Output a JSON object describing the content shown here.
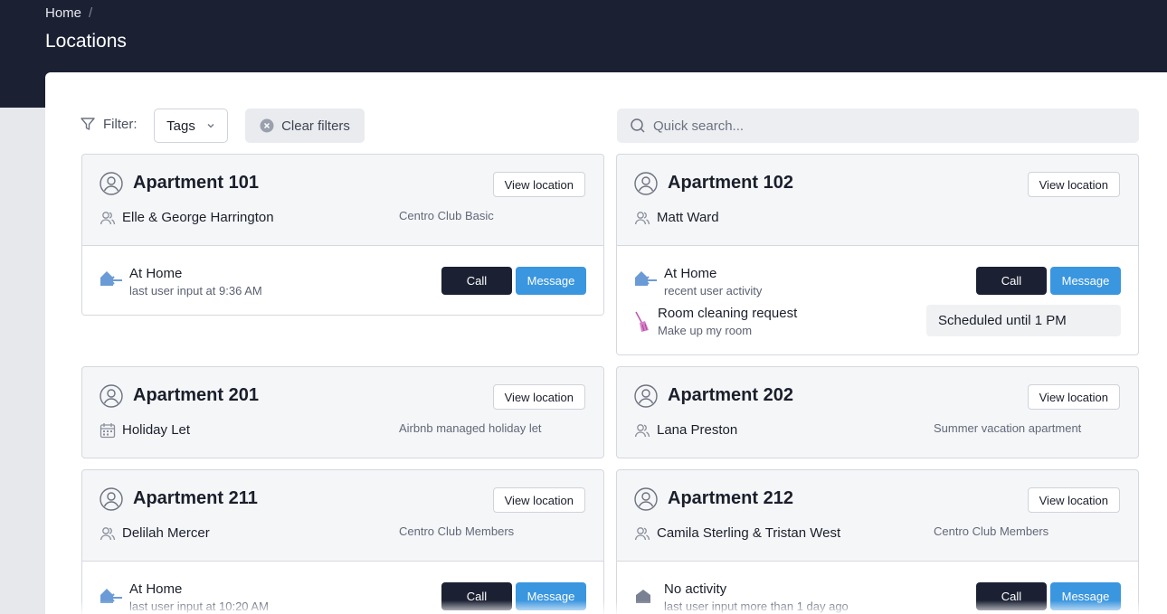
{
  "header": {
    "breadcrumb": [
      "Home"
    ],
    "breadcrumb_sep": "/",
    "title": "Locations"
  },
  "toolbar": {
    "filter_label": "Filter:",
    "tags_label": "Tags",
    "clear_label": "Clear filters",
    "search_placeholder": "Quick search...",
    "search_value": ""
  },
  "buttons": {
    "view": "View location",
    "call": "Call",
    "message": "Message"
  },
  "cards": [
    {
      "title": "Apartment 101",
      "occupant": "Elle & George Harrington",
      "occupant_icon": "users-icon",
      "tag": "Centro Club Basic",
      "status": {
        "icon": "home-arrow-icon",
        "title": "At Home",
        "sub": "last user input at 9:36 AM"
      }
    },
    {
      "title": "Apartment 102",
      "occupant": "Matt Ward",
      "occupant_icon": "users-icon",
      "tag": "",
      "status": {
        "icon": "home-arrow-icon",
        "title": "At Home",
        "sub": "recent user activity"
      },
      "request": {
        "icon": "broom-icon",
        "title": "Room cleaning request",
        "sub": "Make up my room",
        "schedule": "Scheduled until 1 PM"
      }
    },
    {
      "title": "Apartment 201",
      "occupant": "Holiday Let",
      "occupant_icon": "calendar-icon",
      "tag": "Airbnb managed holiday let"
    },
    {
      "title": "Apartment 202",
      "occupant": "Lana Preston",
      "occupant_icon": "users-icon",
      "tag": "Summer vacation apartment"
    },
    {
      "title": "Apartment 211",
      "occupant": "Delilah Mercer",
      "occupant_icon": "users-icon",
      "tag": "Centro Club Members",
      "status": {
        "icon": "home-arrow-icon",
        "title": "At Home",
        "sub": "last user input at 10:20 AM"
      }
    },
    {
      "title": "Apartment 212",
      "occupant": "Camila Sterling & Tristan West",
      "occupant_icon": "users-icon",
      "tag": "Centro Club Members",
      "status": {
        "icon": "home-icon",
        "title": "No activity",
        "sub": "last user input more than 1 day ago"
      }
    }
  ],
  "colors": {
    "header_bg": "#1b2133",
    "call_bg": "#1b2133",
    "message_bg": "#3a96df",
    "home_icon": "#6b9bd6",
    "broom_icon": "#c05ab0"
  }
}
